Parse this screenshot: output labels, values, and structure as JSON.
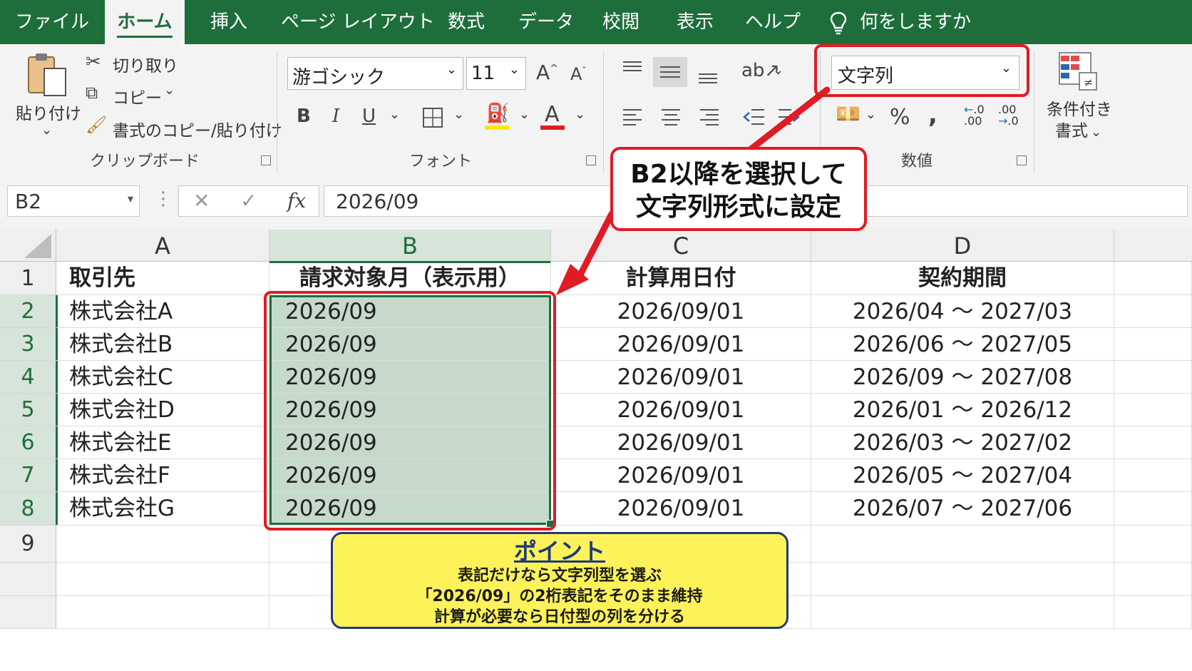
{
  "tabs": [
    "ファイル",
    "ホーム",
    "挿入",
    "ページ レイアウト",
    "数式",
    "データ",
    "校閲",
    "表示",
    "ヘルプ"
  ],
  "active_tab": "ホーム",
  "tell_me": "何をしますか",
  "clipboard": {
    "paste": "貼り付け",
    "cut": "切り取り",
    "copy": "コピー",
    "format_painter": "書式のコピー/貼り付け",
    "group": "クリップボード"
  },
  "font": {
    "name": "游ゴシック",
    "size": "11",
    "group": "フォント",
    "bold": "B",
    "italic": "I",
    "underline": "U",
    "fill_color": "#ffe600",
    "font_color": "#e01b24"
  },
  "number": {
    "format": "文字列",
    "group": "数値",
    "percent": "%",
    "comma": ","
  },
  "styles": {
    "conditional": "条件付き",
    "conditional2": "書式"
  },
  "formula_bar": {
    "name_box": "B2",
    "fx": "fx",
    "value": "2026/09"
  },
  "columns": [
    "A",
    "B",
    "C",
    "D"
  ],
  "rows": [
    "1",
    "2",
    "3",
    "4",
    "5",
    "6",
    "7",
    "8",
    "9"
  ],
  "table": {
    "headers": [
      "取引先",
      "請求対象月（表示用）",
      "計算用日付",
      "契約期間"
    ],
    "data": [
      [
        "株式会社A",
        "2026/09",
        "2026/09/01",
        "2026/04 ～ 2027/03"
      ],
      [
        "株式会社B",
        "2026/09",
        "2026/09/01",
        "2026/06 ～ 2027/05"
      ],
      [
        "株式会社C",
        "2026/09",
        "2026/09/01",
        "2026/09 ～ 2027/08"
      ],
      [
        "株式会社D",
        "2026/09",
        "2026/09/01",
        "2026/01 ～ 2026/12"
      ],
      [
        "株式会社E",
        "2026/09",
        "2026/09/01",
        "2026/03 ～ 2027/02"
      ],
      [
        "株式会社F",
        "2026/09",
        "2026/09/01",
        "2026/05 ～ 2027/04"
      ],
      [
        "株式会社G",
        "2026/09",
        "2026/09/01",
        "2026/07 ～ 2027/06"
      ]
    ]
  },
  "callout": {
    "line1": "B2以降を選択して",
    "line2": "文字列形式に設定"
  },
  "point": {
    "title": "ポイント",
    "line1": "表記だけなら文字列型を選ぶ",
    "line2": "「2026/09」の2桁表記をそのまま維持",
    "line3": "計算が必要なら日付型の列を分ける"
  },
  "colors": {
    "excel_green": "#1e6e3c",
    "highlight_red": "#e01b24",
    "selection_fill": "#c5dacb",
    "point_yellow": "#fdf25a",
    "point_border": "#1f3a7a"
  }
}
